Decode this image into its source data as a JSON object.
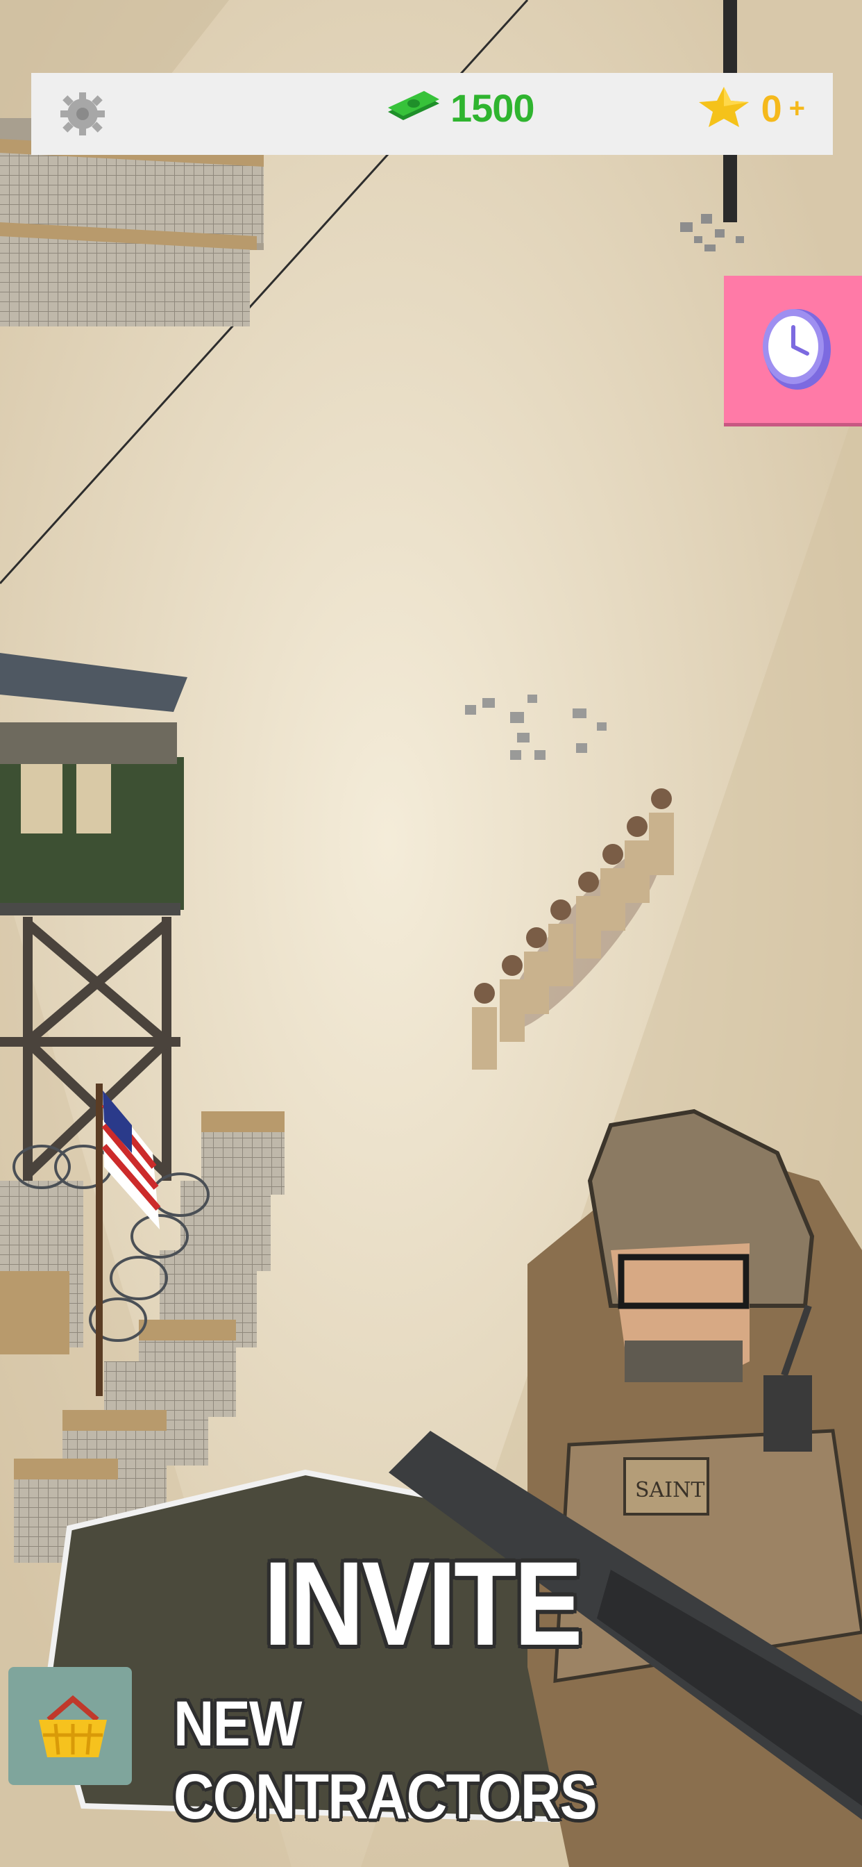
{
  "hud": {
    "settings_icon": "gear-icon",
    "money_icon": "cash-icon",
    "money_value": "1500",
    "stars_icon": "star-icon",
    "stars_value": "0",
    "stars_plus": "+"
  },
  "side_buttons": {
    "timer_icon": "clock-icon",
    "shop_icon": "basket-icon"
  },
  "promo": {
    "title": "INVITE",
    "subtitle": "NEW CONTRACTORS",
    "badge_text": "SAINT"
  },
  "colors": {
    "sand": "#dccfb6",
    "money_green": "#2fb42f",
    "star_gold": "#f5b91c",
    "timer_pink": "#ff7aa7"
  }
}
